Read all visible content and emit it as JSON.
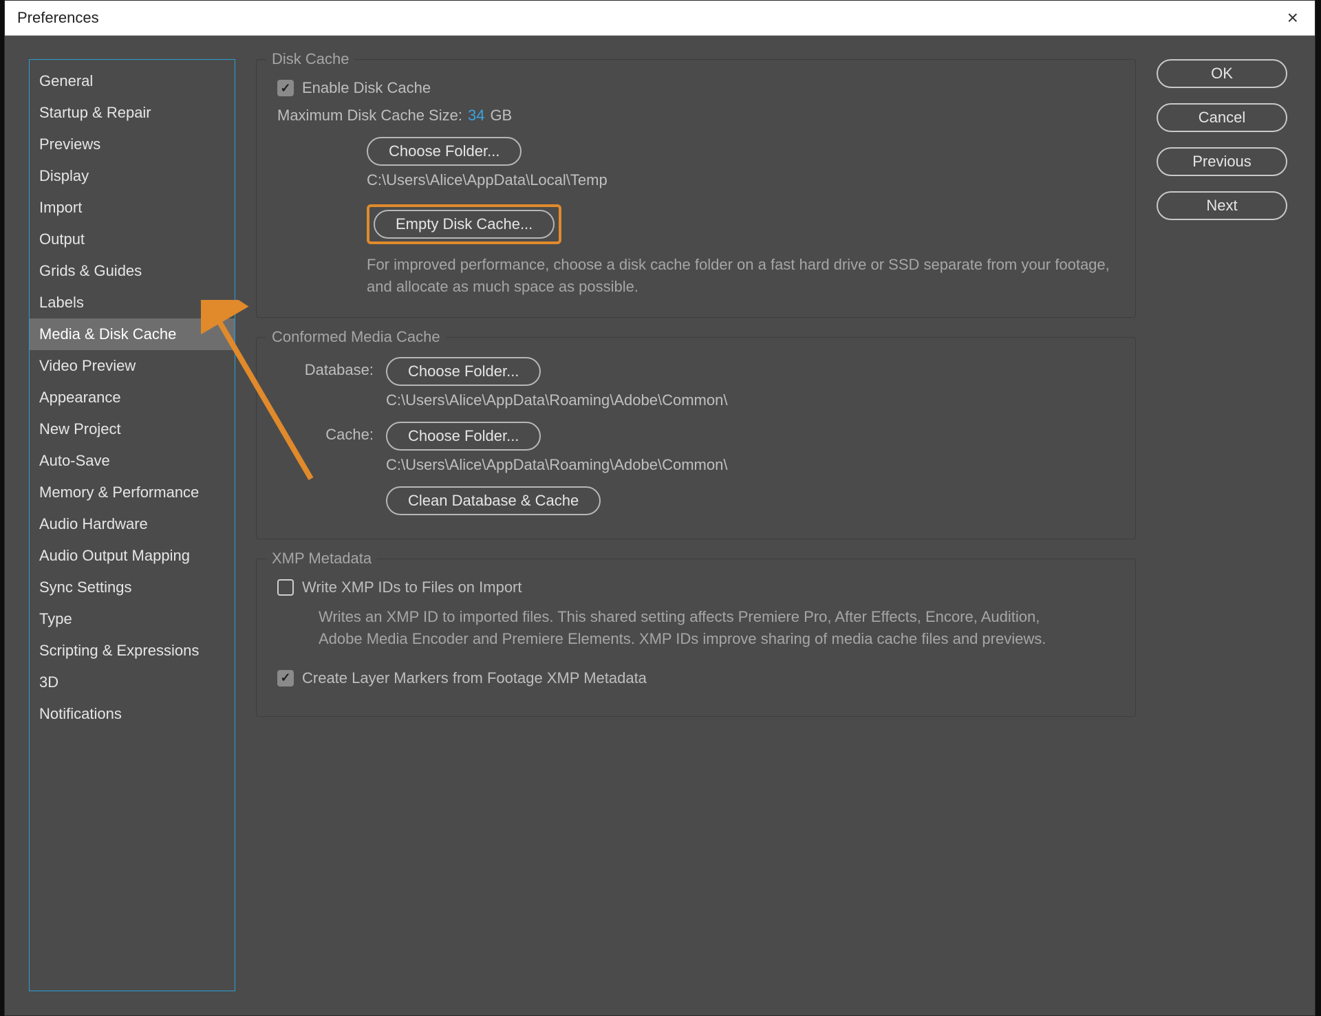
{
  "window": {
    "title": "Preferences",
    "close_icon": "×"
  },
  "sidebar": {
    "items": [
      {
        "label": "General"
      },
      {
        "label": "Startup & Repair"
      },
      {
        "label": "Previews"
      },
      {
        "label": "Display"
      },
      {
        "label": "Import"
      },
      {
        "label": "Output"
      },
      {
        "label": "Grids & Guides"
      },
      {
        "label": "Labels"
      },
      {
        "label": "Media & Disk Cache",
        "selected": true
      },
      {
        "label": "Video Preview"
      },
      {
        "label": "Appearance"
      },
      {
        "label": "New Project"
      },
      {
        "label": "Auto-Save"
      },
      {
        "label": "Memory & Performance"
      },
      {
        "label": "Audio Hardware"
      },
      {
        "label": "Audio Output Mapping"
      },
      {
        "label": "Sync Settings"
      },
      {
        "label": "Type"
      },
      {
        "label": "Scripting & Expressions"
      },
      {
        "label": "3D"
      },
      {
        "label": "Notifications"
      }
    ]
  },
  "buttons": {
    "ok": "OK",
    "cancel": "Cancel",
    "previous": "Previous",
    "next": "Next"
  },
  "disk_cache": {
    "legend": "Disk Cache",
    "enable_label": "Enable Disk Cache",
    "enable_checked": true,
    "max_label": "Maximum Disk Cache Size:",
    "max_value": "34",
    "max_unit": "GB",
    "choose_folder": "Choose Folder...",
    "folder_path": "C:\\Users\\Alice\\AppData\\Local\\Temp",
    "empty_btn": "Empty Disk Cache...",
    "hint": "For improved performance, choose a disk cache folder on a fast hard drive or SSD separate from your footage, and allocate as much space as possible."
  },
  "conformed": {
    "legend": "Conformed Media Cache",
    "db_label": "Database:",
    "db_choose": "Choose Folder...",
    "db_path": "C:\\Users\\Alice\\AppData\\Roaming\\Adobe\\Common\\",
    "cache_label": "Cache:",
    "cache_choose": "Choose Folder...",
    "cache_path": "C:\\Users\\Alice\\AppData\\Roaming\\Adobe\\Common\\",
    "clean_btn": "Clean Database & Cache"
  },
  "xmp": {
    "legend": "XMP Metadata",
    "write_label": "Write XMP IDs to Files on Import",
    "write_checked": false,
    "write_hint": "Writes an XMP ID to imported files. This shared setting affects Premiere Pro, After Effects, Encore, Audition, Adobe Media Encoder and Premiere Elements. XMP IDs improve sharing of media cache files and previews.",
    "markers_label": "Create Layer Markers from Footage XMP Metadata",
    "markers_checked": true
  },
  "annotation": {
    "arrow_color": "#e08a2c"
  }
}
